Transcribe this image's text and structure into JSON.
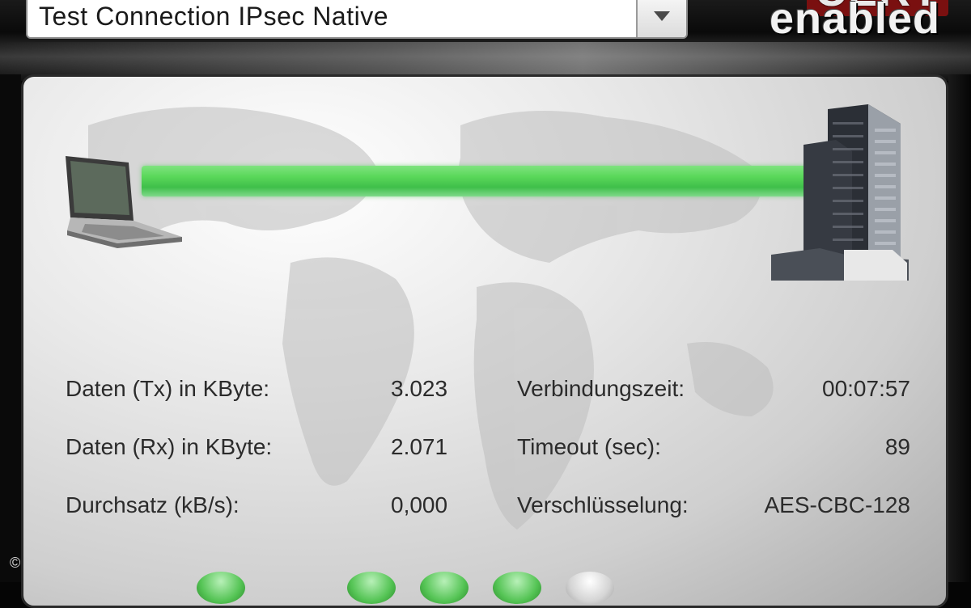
{
  "profile": {
    "selected": "Test Connection IPsec Native"
  },
  "logo": {
    "line1": "CERT",
    "line2": "enabled"
  },
  "connection": {
    "status_color": "#4fd35a"
  },
  "stats": {
    "tx_label": "Daten (Tx) in KByte:",
    "tx_value": "3.023",
    "rx_label": "Daten (Rx) in KByte:",
    "rx_value": "2.071",
    "throughput_label": "Durchsatz (kB/s):",
    "throughput_value": "0,000",
    "conn_time_label": "Verbindungszeit:",
    "conn_time_value": "00:07:57",
    "timeout_label": "Timeout (sec):",
    "timeout_value": "89",
    "encryption_label": "Verschlüsselung:",
    "encryption_value": "AES-CBC-128"
  },
  "footer": {
    "copyright": "©"
  }
}
